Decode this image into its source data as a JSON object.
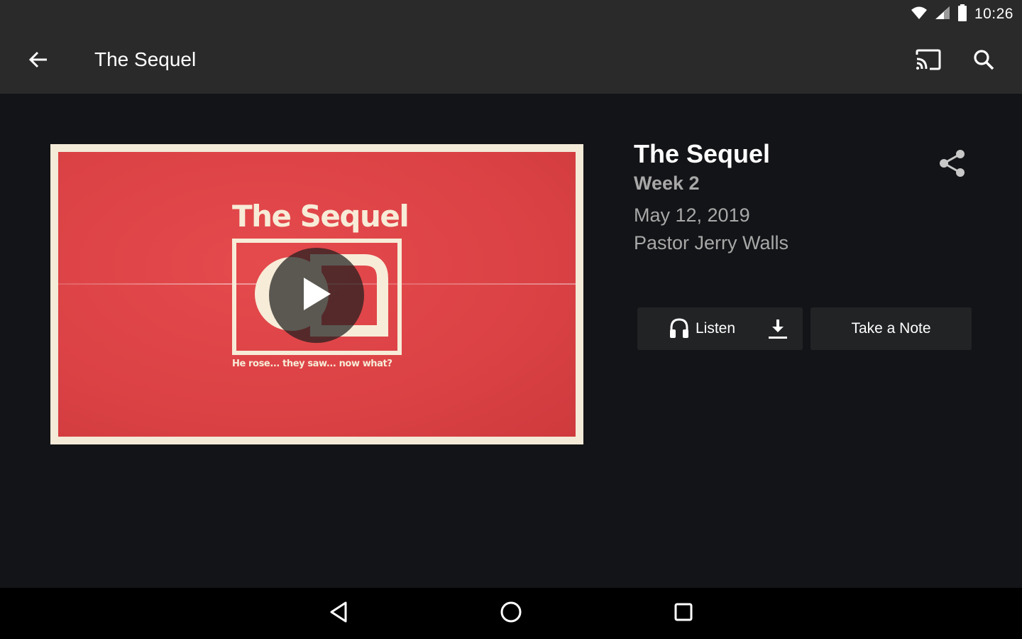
{
  "status_bar": {
    "time": "10:26",
    "icons": [
      "wifi-icon",
      "signal-icon",
      "battery-icon"
    ]
  },
  "app_bar": {
    "title": "The Sequel",
    "icons": [
      "back-arrow-icon",
      "cast-icon",
      "search-icon"
    ]
  },
  "artwork": {
    "title": "The Sequel",
    "tagline": "He rose... they saw... now what?",
    "background_color": "#db4245",
    "accent_color": "#f7ecd8"
  },
  "sermon": {
    "title": "The Sequel",
    "week": "Week 2",
    "date": "May 12, 2019",
    "speaker": "Pastor Jerry Walls"
  },
  "actions": {
    "listen_label": "Listen",
    "note_label": "Take a Note",
    "icons": [
      "headphones-icon",
      "download-icon",
      "share-icon"
    ]
  },
  "nav_bar": {
    "icons": [
      "nav-back-icon",
      "nav-home-icon",
      "nav-recents-icon"
    ]
  }
}
